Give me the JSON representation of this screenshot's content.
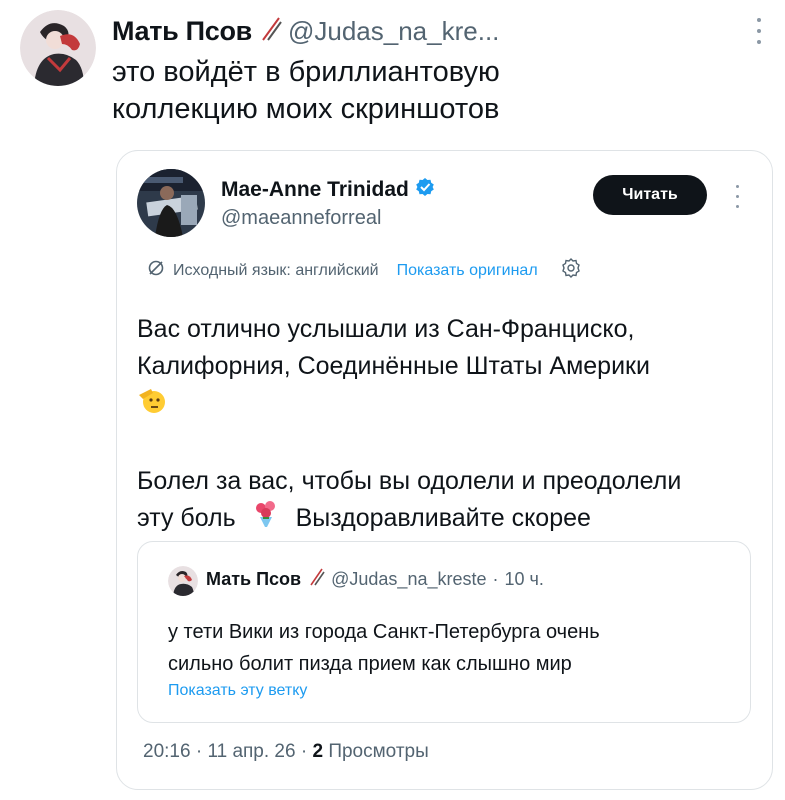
{
  "post": {
    "author_name": "Мать Псов",
    "author_handle": "@Judas_na_kre...",
    "text_lines": [
      "это войдёт в бриллиантовую",
      "коллекцию моих скриншотов"
    ]
  },
  "embedded": {
    "author_name": "Mae-Anne Trinidad",
    "author_handle": "@maeanneforreal",
    "follow_label": "Читать",
    "translation": {
      "source_text": "Исходный язык: английский",
      "show_original": "Показать оригинал"
    },
    "body": {
      "line1": "Вас отлично услышали из Сан-Франциско,",
      "line2": "Калифорния, Соединённые Штаты Америки",
      "line3a": "Болел за вас, чтобы вы одолели и преодолели",
      "line4a": "эту боль",
      "line4b": "Выздоравливайте скорее"
    },
    "quote": {
      "author_name": "Мать Псов",
      "author_handle": "@Judas_na_kreste",
      "separator": "·",
      "time": "10 ч.",
      "text_lines": [
        "у тети Вики из города Санкт-Петербурга очень",
        "сильно болит пизда прием как слышно мир"
      ],
      "show_thread": "Показать эту ветку"
    },
    "footer": {
      "time": "20:16",
      "date": "11 апр. 26",
      "sep": "·",
      "views_count": "2",
      "views_label": "Просмотры"
    }
  },
  "icons": {
    "verified": "verified-badge-icon",
    "pencil": "pencil-icon",
    "translate": "translate-icon",
    "settings": "gear-icon",
    "more": "more-vertical-icon",
    "emoji_salute": "saluting-face-emoji",
    "emoji_bouquet": "bouquet-emoji"
  },
  "colors": {
    "accent": "#1d9bf0",
    "text": "#0f1419",
    "secondary": "#536471",
    "button_bg": "#0f1419"
  }
}
